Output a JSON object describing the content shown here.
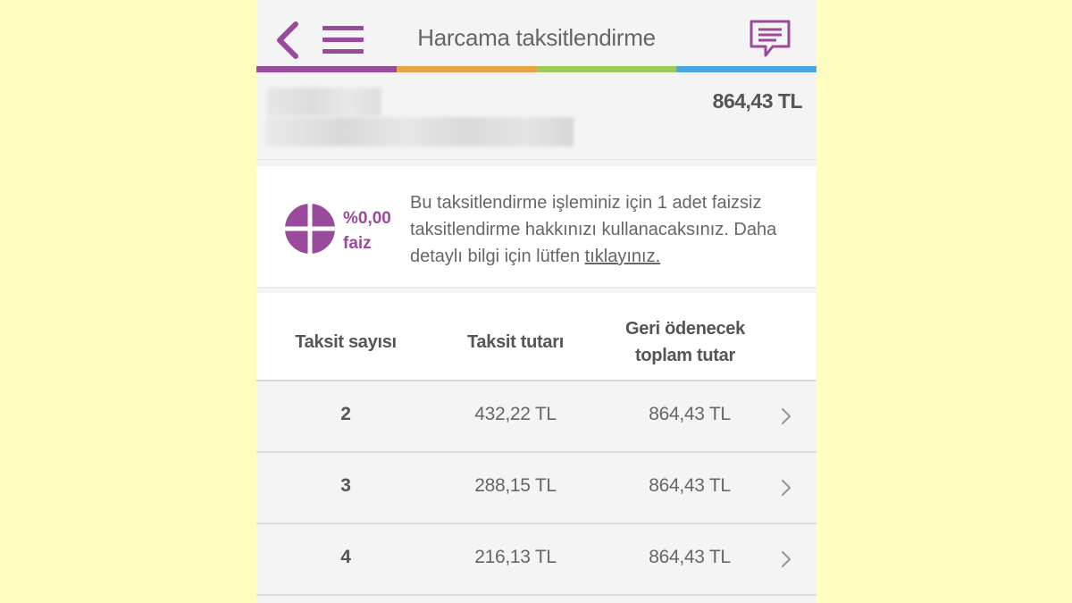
{
  "header": {
    "title": "Harcama taksitlendirme",
    "stripe_colors": [
      "#9a4a9c",
      "#e8a34b",
      "#9ccb5a",
      "#4aa8e0"
    ],
    "accent": "#9a4a9c"
  },
  "account": {
    "amount": "864,43 TL"
  },
  "info": {
    "rate": "%0,00",
    "rate_label": "faiz",
    "text": "Bu taksitlendirme işleminiz için 1 adet faizsiz taksitlendirme hakkınızı kullanacaksınız. Daha detaylı bilgi için lütfen ",
    "link": "tıklayınız."
  },
  "table": {
    "headers": {
      "count": "Taksit sayısı",
      "installment": "Taksit tutarı",
      "total_line1": "Geri ödenecek",
      "total_line2": "toplam tutar"
    },
    "rows": [
      {
        "count": "2",
        "installment": "432,22 TL",
        "total": "864,43 TL"
      },
      {
        "count": "3",
        "installment": "288,15 TL",
        "total": "864,43 TL"
      },
      {
        "count": "4",
        "installment": "216,13 TL",
        "total": "864,43 TL"
      }
    ]
  },
  "icons": {
    "back": "chevron-left-icon",
    "menu": "hamburger-menu-icon",
    "chat": "chat-message-icon",
    "rate": "pie-quarters-icon",
    "row": "chevron-right-icon"
  }
}
